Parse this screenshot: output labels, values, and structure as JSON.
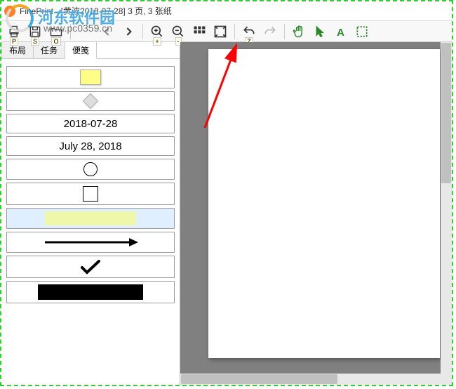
{
  "window": {
    "title": "FinePrint - [黄波2018-07-28] 3 页, 3 张纸"
  },
  "watermark": {
    "site_name": "河东软件园",
    "url": "www.pc0359.cn"
  },
  "toolbar": {
    "hotkeys": {
      "p": "P",
      "s": "S",
      "o": "O",
      "plus": "+",
      "minus": "-",
      "z": "Z"
    }
  },
  "tabs": {
    "layout": "布局",
    "tasks": "任务",
    "stamps": "便笺"
  },
  "stamps": {
    "date_iso": "2018-07-28",
    "date_long": "July 28, 2018"
  }
}
